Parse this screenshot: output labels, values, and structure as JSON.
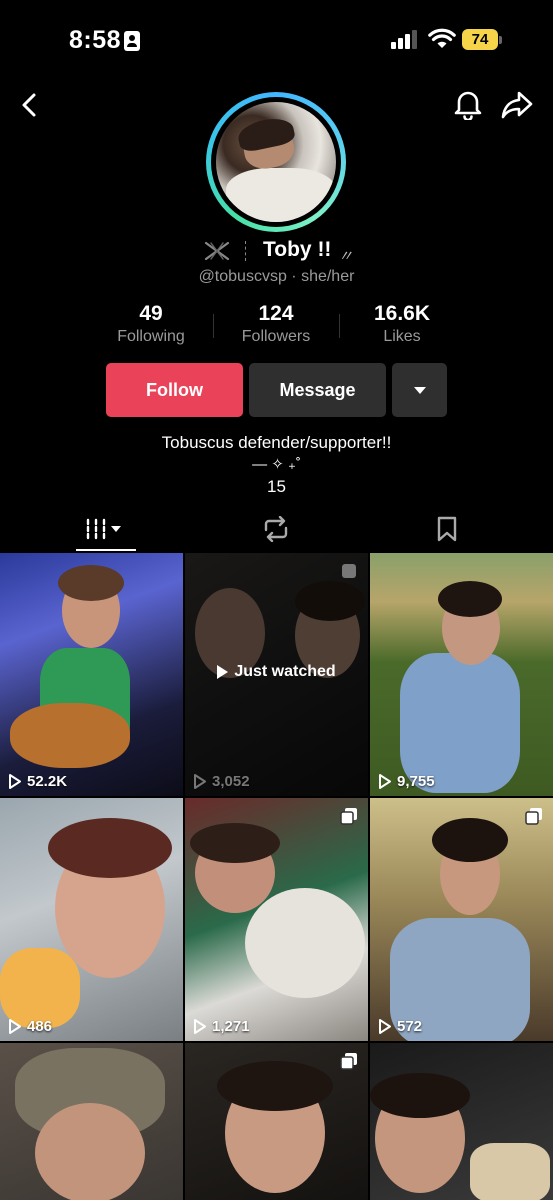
{
  "status_bar": {
    "time": "8:58",
    "battery": "74"
  },
  "header": {
    "back_icon": "chevron-left-icon",
    "bell_icon": "bell-icon",
    "share_icon": "share-arrow-icon"
  },
  "profile": {
    "name": "Toby !!",
    "name_decoration": "〃",
    "handle": "@tobuscvsp · she/her",
    "stats": [
      {
        "value": "49",
        "label": "Following"
      },
      {
        "value": "124",
        "label": "Followers"
      },
      {
        "value": "16.6K",
        "label": "Likes"
      }
    ],
    "buttons": {
      "follow": "Follow",
      "message": "Message"
    },
    "bio": {
      "line1": "Tobuscus defender/supporter!!",
      "line2": "— ✧ ₊˚",
      "line3": "15"
    }
  },
  "tabs": [
    {
      "name": "videos",
      "icon": "grid-videos-icon",
      "active": true
    },
    {
      "name": "reposts",
      "icon": "repost-icon",
      "active": false
    },
    {
      "name": "favorites",
      "icon": "bookmark-icon",
      "active": false
    }
  ],
  "videos": [
    {
      "views": "52.2K",
      "just_watched": false,
      "multi": false
    },
    {
      "views": "3,052",
      "just_watched": true,
      "just_watched_label": "Just watched",
      "multi": true
    },
    {
      "views": "9,755",
      "just_watched": false,
      "multi": false
    },
    {
      "views": "486",
      "just_watched": false,
      "multi": false
    },
    {
      "views": "1,271",
      "just_watched": false,
      "multi": true
    },
    {
      "views": "572",
      "just_watched": false,
      "multi": true
    },
    {
      "views": "",
      "just_watched": false,
      "multi": false
    },
    {
      "views": "",
      "just_watched": false,
      "multi": true
    },
    {
      "views": "",
      "just_watched": false,
      "multi": false
    }
  ],
  "colors": {
    "follow_button": "#ea4359",
    "secondary_button": "#2f2f2f",
    "battery": "#f5d44a"
  }
}
